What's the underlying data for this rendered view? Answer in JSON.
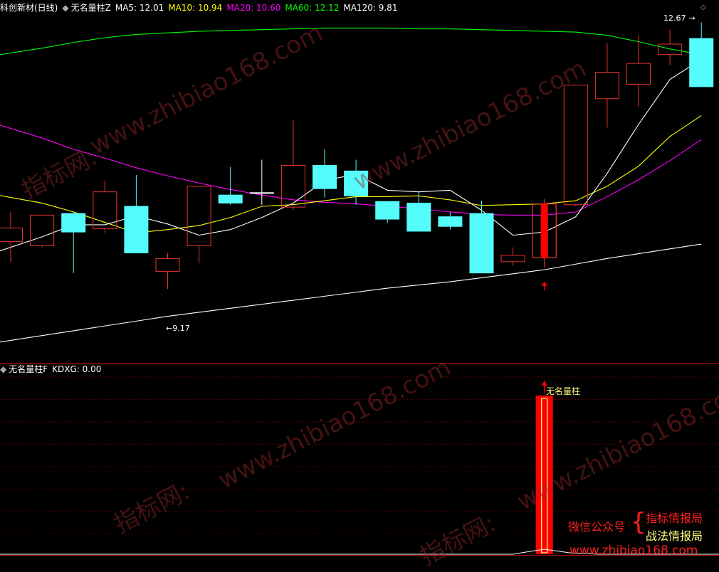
{
  "header": {
    "panel1": {
      "title": "科创新材(日线)",
      "indicator": "无名量柱Z",
      "ma5": "MA5: 12.01",
      "ma10": "MA10: 10.94",
      "ma20": "MA20: 10.60",
      "ma60": "MA60: 12.12",
      "ma120": "MA120: 9.81"
    },
    "panel2": {
      "indicator": "无名量柱F",
      "kdxg": "KDXG: 0.00"
    }
  },
  "annotations": {
    "high_label": "12.67",
    "low_label": "9.17",
    "signal_label": "无名量柱"
  },
  "watermark": {
    "url": "www.zhibiao168.com",
    "site": "指标网:"
  },
  "promo": {
    "wechat": "微信公众号",
    "line1": "指标情报局",
    "line2": "战法情报局",
    "url": "www.zhibiao168.com"
  },
  "colors": {
    "up": "#e8362e",
    "down": "#54fcfc",
    "signal": "#ff0000",
    "ma5": "#ffffff",
    "ma10": "#ffff00",
    "ma20": "#ff00ff",
    "ma60": "#00ff00",
    "ma120": "#ffffff",
    "grid": "#8b0000"
  },
  "chart_data": [
    {
      "type": "candlestick",
      "title": "科创新材(日线)",
      "ylim": [
        8.7,
        12.9
      ],
      "candles": [
        {
          "open": 10.05,
          "close": 10.22,
          "high": 10.42,
          "low": 9.8,
          "dir": "up"
        },
        {
          "open": 10.0,
          "close": 10.38,
          "high": 10.38,
          "low": 9.98,
          "dir": "up"
        },
        {
          "open": 10.4,
          "close": 10.17,
          "high": 10.42,
          "low": 9.66,
          "dir": "down"
        },
        {
          "open": 10.21,
          "close": 10.67,
          "high": 10.81,
          "low": 10.16,
          "dir": "up"
        },
        {
          "open": 10.49,
          "close": 9.91,
          "high": 10.88,
          "low": 9.91,
          "dir": "down"
        },
        {
          "open": 9.68,
          "close": 9.84,
          "high": 9.91,
          "low": 9.46,
          "dir": "up"
        },
        {
          "open": 10.0,
          "close": 10.74,
          "high": 10.74,
          "low": 9.78,
          "dir": "up"
        },
        {
          "open": 10.63,
          "close": 10.53,
          "high": 10.98,
          "low": 10.51,
          "dir": "down"
        },
        {
          "open": 10.66,
          "close": 10.66,
          "high": 11.07,
          "low": 10.51,
          "dir": "flat"
        },
        {
          "open": 10.48,
          "close": 11.0,
          "high": 11.56,
          "low": 10.44,
          "dir": "up"
        },
        {
          "open": 11.0,
          "close": 10.71,
          "high": 11.2,
          "low": 10.6,
          "dir": "down"
        },
        {
          "open": 10.93,
          "close": 10.62,
          "high": 11.07,
          "low": 10.51,
          "dir": "down"
        },
        {
          "open": 10.55,
          "close": 10.33,
          "high": 10.55,
          "low": 10.28,
          "dir": "down"
        },
        {
          "open": 10.53,
          "close": 10.18,
          "high": 10.67,
          "low": 10.18,
          "dir": "down"
        },
        {
          "open": 10.36,
          "close": 10.24,
          "high": 10.42,
          "low": 10.2,
          "dir": "down"
        },
        {
          "open": 10.4,
          "close": 9.66,
          "high": 10.56,
          "low": 9.66,
          "dir": "down"
        },
        {
          "open": 9.8,
          "close": 9.88,
          "high": 9.98,
          "low": 9.75,
          "dir": "up"
        },
        {
          "open": 9.85,
          "close": 10.52,
          "high": 10.58,
          "low": 9.73,
          "dir": "signal"
        },
        {
          "open": 10.51,
          "close": 12.0,
          "high": 12.0,
          "low": 10.49,
          "dir": "up"
        },
        {
          "open": 11.83,
          "close": 12.16,
          "high": 12.52,
          "low": 11.47,
          "dir": "up"
        },
        {
          "open": 12.01,
          "close": 12.27,
          "high": 12.62,
          "low": 11.73,
          "dir": "up"
        },
        {
          "open": 12.38,
          "close": 12.51,
          "high": 12.69,
          "low": 12.25,
          "dir": "up"
        },
        {
          "open": 12.58,
          "close": 11.98,
          "high": 12.78,
          "low": 11.98,
          "dir": "down"
        }
      ],
      "ma5": [
        9.98,
        10.11,
        10.26,
        10.26,
        10.37,
        10.27,
        10.13,
        10.2,
        10.35,
        10.53,
        10.81,
        10.89,
        10.69,
        10.67,
        10.69,
        10.44,
        10.13,
        10.17,
        10.36,
        10.9,
        11.51,
        12.07,
        12.32
      ],
      "ma10": [
        10.6,
        10.53,
        10.42,
        10.29,
        10.16,
        10.2,
        10.25,
        10.35,
        10.49,
        10.51,
        10.56,
        10.61,
        10.61,
        10.62,
        10.57,
        10.5,
        10.51,
        10.52,
        10.56,
        10.74,
        10.99,
        11.36,
        11.62
      ],
      "ma20": [
        11.46,
        11.34,
        11.2,
        11.09,
        10.97,
        10.87,
        10.78,
        10.7,
        10.63,
        10.57,
        10.54,
        10.52,
        10.49,
        10.46,
        10.42,
        10.39,
        10.38,
        10.38,
        10.42,
        10.61,
        10.82,
        11.06,
        11.32
      ],
      "ma60": [
        12.4,
        12.46,
        12.53,
        12.59,
        12.63,
        12.65,
        12.67,
        12.68,
        12.69,
        12.7,
        12.71,
        12.71,
        12.71,
        12.7,
        12.7,
        12.69,
        12.68,
        12.67,
        12.66,
        12.62,
        12.54,
        12.45,
        12.38
      ],
      "ma120": [
        8.82,
        8.88,
        8.94,
        9.0,
        9.06,
        9.12,
        9.17,
        9.22,
        9.27,
        9.32,
        9.37,
        9.42,
        9.47,
        9.51,
        9.55,
        9.6,
        9.65,
        9.7,
        9.77,
        9.84,
        9.9,
        9.96,
        10.02
      ]
    },
    {
      "type": "bar",
      "title": "无名量柱F",
      "series": [
        {
          "name": "KDXG",
          "values": [
            0,
            0,
            0,
            0,
            0,
            0,
            0,
            0,
            0,
            0,
            0,
            0,
            0,
            0,
            0,
            0,
            0,
            1,
            0,
            0,
            0,
            0,
            0
          ]
        }
      ]
    }
  ]
}
